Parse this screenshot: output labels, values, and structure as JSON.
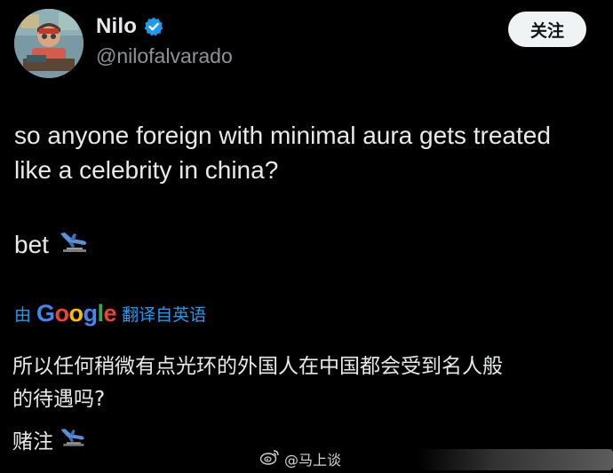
{
  "user": {
    "display_name": "Nilo",
    "handle": "@nilofalvarado",
    "verified": true
  },
  "follow_button": {
    "label": "关注"
  },
  "tweet": {
    "line1": "so anyone foreign with minimal aura gets treated",
    "line2": "like a celebrity in china?",
    "line3": "bet",
    "emoji": "airplane-landing-icon"
  },
  "translation": {
    "prefix": "由",
    "brand": "Google",
    "suffix": "翻译自英语",
    "text_line1": "所以任何稍微有点光环的外国人在中国都会受到名人般",
    "text_line2": "的待遇吗?",
    "text_line3": "赌注"
  },
  "watermark": {
    "text": "@马上谈"
  },
  "colors": {
    "background": "#000000",
    "text": "#e7e9ea",
    "muted": "#8b9399",
    "accent": "#1d9bf0",
    "follow_bg": "#eff3f4"
  }
}
